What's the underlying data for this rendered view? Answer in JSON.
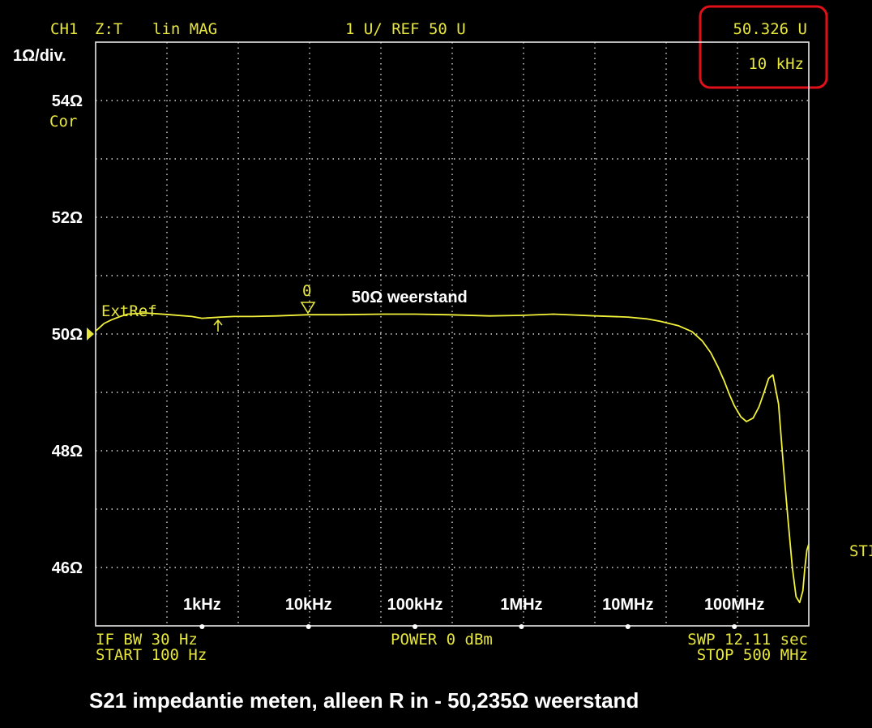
{
  "header": {
    "channel": "CH1",
    "format": "Z:T",
    "scale_mode": "lin MAG",
    "scale_ref": "1 U/ REF 50 U",
    "marker_value": "50.326 U",
    "marker_freq": "10 kHz",
    "cor": "Cor",
    "div_label": "1Ω/div."
  },
  "footer": {
    "ifbw": "IF BW 30 Hz",
    "start": "START 100 Hz",
    "power": "POWER 0 dBm",
    "swp": "SWP 12.11 sec",
    "stop": "STOP 500 MHz",
    "right_edge": "STI"
  },
  "annotations": {
    "extref": "ExtRef",
    "marker_number": "0",
    "trace_label": "50Ω weerstand",
    "caption": "S21 impedantie meten, alleen R in - 50,235Ω weerstand"
  },
  "colors": {
    "trace": "#f2f23a",
    "text": "#e6e63c",
    "highlight": "#e0101a",
    "grid": "#d8d8d8"
  },
  "chart_data": {
    "type": "line",
    "title": "S21 impedantie meten, alleen R in - 50,235Ω weerstand",
    "xscale": "log",
    "xlim": [
      100,
      500000000
    ],
    "ylim": [
      45,
      55
    ],
    "y_ticks": [
      {
        "value": 54,
        "label": "54Ω"
      },
      {
        "value": 52,
        "label": "52Ω"
      },
      {
        "value": 50,
        "label": "50Ω"
      },
      {
        "value": 48,
        "label": "48Ω"
      },
      {
        "value": 46,
        "label": "46Ω"
      }
    ],
    "x_ticks": [
      {
        "value": 1000,
        "label": "1kHz"
      },
      {
        "value": 10000,
        "label": "10kHz"
      },
      {
        "value": 100000,
        "label": "100kHz"
      },
      {
        "value": 1000000,
        "label": "1MHz"
      },
      {
        "value": 10000000,
        "label": "10MHz"
      },
      {
        "value": 100000000,
        "label": "100MHz"
      }
    ],
    "marker": {
      "freq": 10000,
      "value": 50.326
    },
    "series": [
      {
        "name": "50Ω weerstand",
        "x": [
          100,
          120,
          140,
          170,
          200,
          300,
          500,
          800,
          1000,
          1500,
          2000,
          3000,
          5000,
          10000,
          20000,
          50000,
          100000,
          200000,
          500000,
          1000000,
          2000000,
          5000000,
          10000000,
          15000000,
          20000000,
          30000000,
          40000000,
          50000000,
          60000000,
          70000000,
          80000000,
          90000000,
          100000000,
          115000000,
          130000000,
          150000000,
          170000000,
          190000000,
          210000000,
          230000000,
          260000000,
          290000000,
          320000000,
          350000000,
          380000000,
          410000000,
          440000000,
          460000000,
          480000000,
          500000000
        ],
        "y": [
          50.05,
          50.18,
          50.24,
          50.3,
          50.34,
          50.36,
          50.33,
          50.3,
          50.27,
          50.29,
          50.3,
          50.3,
          50.31,
          50.33,
          50.33,
          50.34,
          50.34,
          50.33,
          50.31,
          50.32,
          50.34,
          50.31,
          50.29,
          50.26,
          50.22,
          50.14,
          50.04,
          49.88,
          49.68,
          49.44,
          49.2,
          48.96,
          48.77,
          48.58,
          48.5,
          48.56,
          48.75,
          49.0,
          49.24,
          49.3,
          48.8,
          47.7,
          46.8,
          46.0,
          45.5,
          45.4,
          45.6,
          46.0,
          46.3,
          46.4
        ]
      }
    ]
  }
}
